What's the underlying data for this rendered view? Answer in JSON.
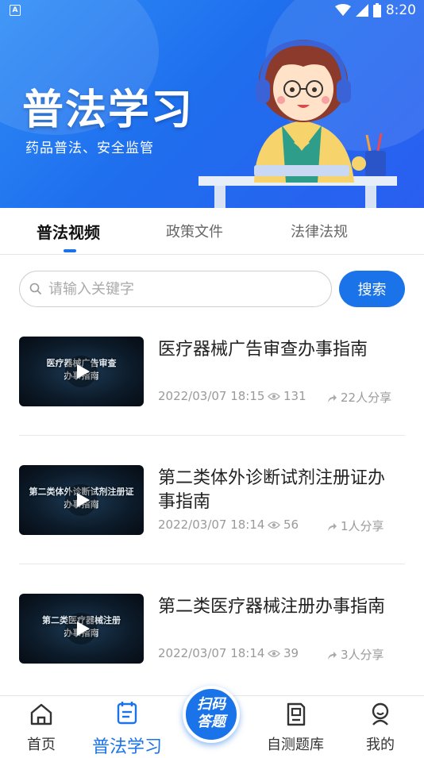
{
  "status_bar": {
    "left_badge": "A",
    "time": "8:20"
  },
  "banner": {
    "title": "普法学习",
    "subtitle": "药品普法、安全监管"
  },
  "tabs": [
    {
      "label": "普法视频",
      "active": true
    },
    {
      "label": "政策文件",
      "active": false
    },
    {
      "label": "法律法规",
      "active": false
    }
  ],
  "search": {
    "placeholder": "请输入关键字",
    "button_label": "搜索"
  },
  "videos": [
    {
      "title": "医疗器械广告审查办事指南",
      "thumb_text": "医疗器械广告审查\n办事指南",
      "date": "2022/03/07 18:15",
      "views": "131",
      "shares": "22人分享"
    },
    {
      "title": "第二类体外诊断试剂注册证办事指南",
      "thumb_text": "第二类体外诊断试剂注册证\n办事指南",
      "date": "2022/03/07 18:14",
      "views": "56",
      "shares": "1人分享"
    },
    {
      "title": "第二类医疗器械注册办事指南",
      "thumb_text": "第二类医疗器械注册\n办事指南",
      "date": "2022/03/07 18:14",
      "views": "39",
      "shares": "3人分享"
    }
  ],
  "bottom_nav": {
    "items": [
      {
        "label": "首页",
        "icon": "home-icon",
        "active": false
      },
      {
        "label": "普法学习",
        "icon": "notes-icon",
        "active": true
      },
      {
        "label": "自测题库",
        "icon": "question-bank-icon",
        "active": false
      },
      {
        "label": "我的",
        "icon": "profile-icon",
        "active": false
      }
    ],
    "scan_button": {
      "line1": "扫码",
      "line2": "答题"
    }
  },
  "colors": {
    "accent": "#1a73e8",
    "banner": "#2a6ff0"
  }
}
